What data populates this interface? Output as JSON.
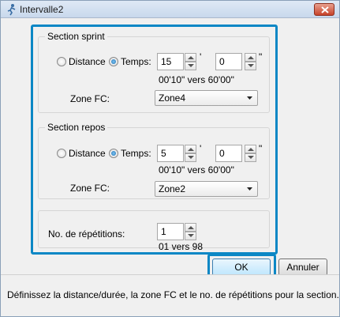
{
  "window": {
    "title": "Intervalle2"
  },
  "sprint": {
    "title": "Section sprint",
    "distance_label": "Distance",
    "temps_label": "Temps:",
    "selected": "temps",
    "minutes": "15",
    "seconds": "0",
    "min_mark": "'",
    "sec_mark": "\"",
    "range": "00'10\" vers 60'00\"",
    "zone_label": "Zone FC:",
    "zone_value": "Zone4"
  },
  "repos": {
    "title": "Section repos",
    "distance_label": "Distance",
    "temps_label": "Temps:",
    "selected": "temps",
    "minutes": "5",
    "seconds": "0",
    "min_mark": "'",
    "sec_mark": "\"",
    "range": "00'10\" vers 60'00\"",
    "zone_label": "Zone FC:",
    "zone_value": "Zone2"
  },
  "repetitions": {
    "label": "No. de répétitions:",
    "value": "1",
    "range": "01 vers 98"
  },
  "buttons": {
    "ok": "OK",
    "cancel": "Annuler"
  },
  "status": {
    "text": "Définissez la distance/durée, la zone FC et le no. de répétitions pour la section."
  },
  "colors": {
    "highlight": "#0b87c5",
    "close": "#c7432a"
  }
}
